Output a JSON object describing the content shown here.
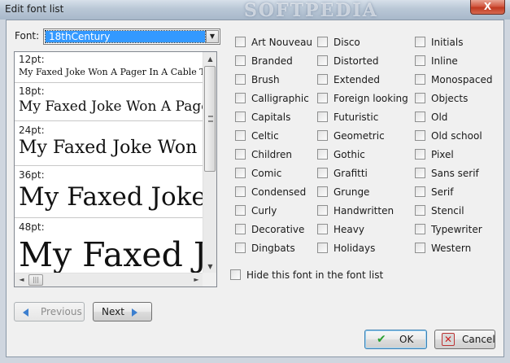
{
  "window": {
    "title": "Edit font list",
    "close_glyph": "X",
    "watermark": "SOFTPEDIA"
  },
  "font_selector": {
    "label": "Font:",
    "selected": "18thCentury",
    "dropdown_glyph": "▼"
  },
  "preview": {
    "samples": [
      {
        "size_label": "12pt:",
        "text": "My Faxed Joke Won A Pager In A Cable TV Quiz Show"
      },
      {
        "size_label": "18pt:",
        "text": "My Faxed Joke Won A Pager In A Cable TV Quiz Show"
      },
      {
        "size_label": "24pt:",
        "text": "My Faxed Joke Won A Pager In A Cable TV Quiz Show"
      },
      {
        "size_label": "36pt:",
        "text": "My Faxed Joke Won A Pager In A Cable TV Quiz Show"
      },
      {
        "size_label": "48pt:",
        "text": "My Faxed Joke Won A Pager In A Cable TV Quiz Show"
      }
    ],
    "scroll_up_glyph": "▲",
    "scroll_down_glyph": "▼",
    "scroll_left_glyph": "◄",
    "scroll_right_glyph": "►",
    "h_grip_glyph": "|||"
  },
  "nav": {
    "previous_label": "Previous",
    "next_label": "Next"
  },
  "categories": {
    "col1": [
      "Art Nouveau",
      "Branded",
      "Brush",
      "Calligraphic",
      "Capitals",
      "Celtic",
      "Children",
      "Comic",
      "Condensed",
      "Curly",
      "Decorative",
      "Dingbats"
    ],
    "col2": [
      "Disco",
      "Distorted",
      "Extended",
      "Foreign looking",
      "Futuristic",
      "Geometric",
      "Gothic",
      "Grafitti",
      "Grunge",
      "Handwritten",
      "Heavy",
      "Holidays"
    ],
    "col3": [
      "Initials",
      "Inline",
      "Monospaced",
      "Objects",
      "Old",
      "Old school",
      "Pixel",
      "Sans serif",
      "Serif",
      "Stencil",
      "Typewriter",
      "Western"
    ]
  },
  "hide_checkbox": {
    "label": "Hide this font in the font list"
  },
  "dialog_buttons": {
    "ok_label": "OK",
    "ok_glyph": "✔",
    "cancel_label": "Cancel",
    "cancel_glyph": "✕"
  }
}
